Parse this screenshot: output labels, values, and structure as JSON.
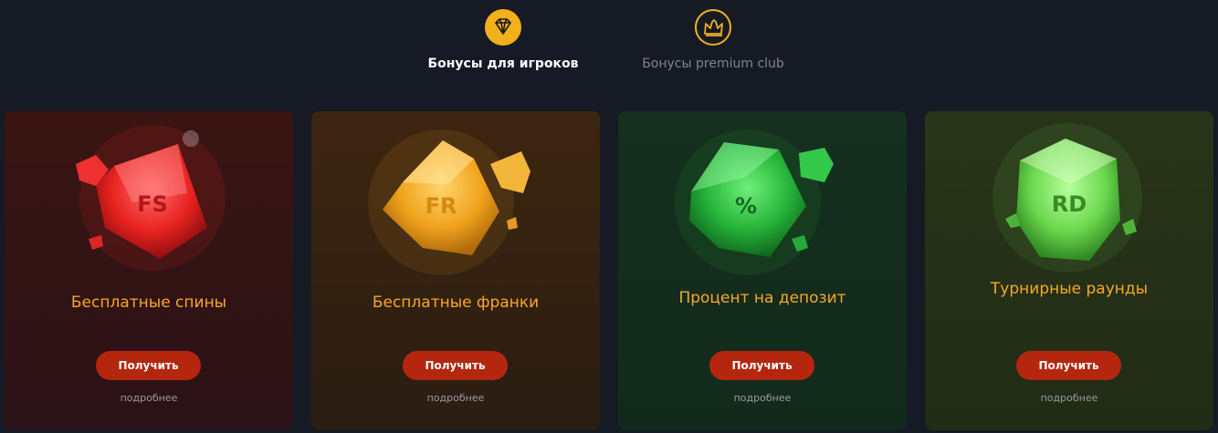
{
  "tabs": [
    {
      "label": "Бонусы для игроков",
      "icon": "diamond-icon",
      "active": true
    },
    {
      "label": "Бонусы premium club",
      "icon": "crown-icon",
      "active": false
    }
  ],
  "colors": {
    "accent": "#f2b01c",
    "button": "#b5260f",
    "title": "#f7a826",
    "background": "#151a24"
  },
  "cards": [
    {
      "gem_text": "FS",
      "title": "Бесплатные спины",
      "button_label": "Получить",
      "more_label": "подробнее",
      "gem_color": "red"
    },
    {
      "gem_text": "FR",
      "title": "Бесплатные франки",
      "button_label": "Получить",
      "more_label": "подробнее",
      "gem_color": "orange"
    },
    {
      "gem_text": "%",
      "title": "Процент на депозит",
      "button_label": "Получить",
      "more_label": "подробнее",
      "gem_color": "green"
    },
    {
      "gem_text": "RD",
      "title": "Турнирные раунды",
      "button_label": "Получить",
      "more_label": "подробнее",
      "gem_color": "light-green"
    }
  ]
}
